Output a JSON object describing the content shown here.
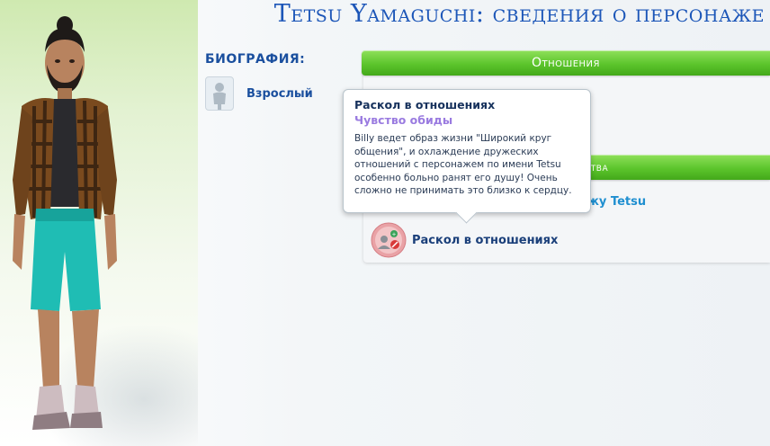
{
  "title": "Tetsu Yamaguchi: сведения о персонаже",
  "biography": {
    "label": "БИОГРАФИЯ:",
    "age_icon": "adult-silhouette-icon",
    "age_label": "Взрослый"
  },
  "relationships_tab": "Отношения",
  "properties_tab_partial": "ства",
  "properties_text_partial": "жу Tetsu",
  "moodlet": {
    "icon": "broken-friendship-icon",
    "label": "Раскол в отношениях"
  },
  "tooltip": {
    "title": "Раскол в отношениях",
    "subtitle": "Чувство обиды",
    "body": "Billy ведет образ жизни \"Широкий круг общения\", и охлаждение дружеских отношений с персонажем по имени Tetsu особенно больно ранят его душу! Очень сложно не принимать это близко к сердцу."
  },
  "colors": {
    "title_blue": "#1c56b8",
    "green_bar": "#5cc52c",
    "tooltip_subtitle": "#9a7be0",
    "link_blue": "#1f8fd0"
  }
}
